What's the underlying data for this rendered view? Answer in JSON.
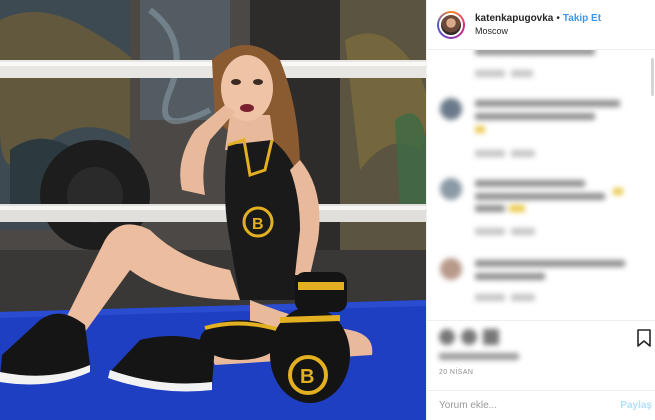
{
  "header": {
    "username": "katenkapugovka",
    "separator": "•",
    "follow_label": "Takip Et",
    "location": "Moscow"
  },
  "post": {
    "date": "20 NİSAN"
  },
  "comment_box": {
    "placeholder": "Yorum ekle...",
    "post_label": "Paylaş"
  },
  "icons": {
    "avatar": "avatar",
    "bookmark": "bookmark-icon",
    "like": "heart-icon",
    "comment": "comment-icon",
    "share": "share-icon"
  },
  "colors": {
    "follow": "#3897f0",
    "post_button": "#b2dffc",
    "mat": "#1f3fc2",
    "accent_yellow": "#e2b020"
  }
}
